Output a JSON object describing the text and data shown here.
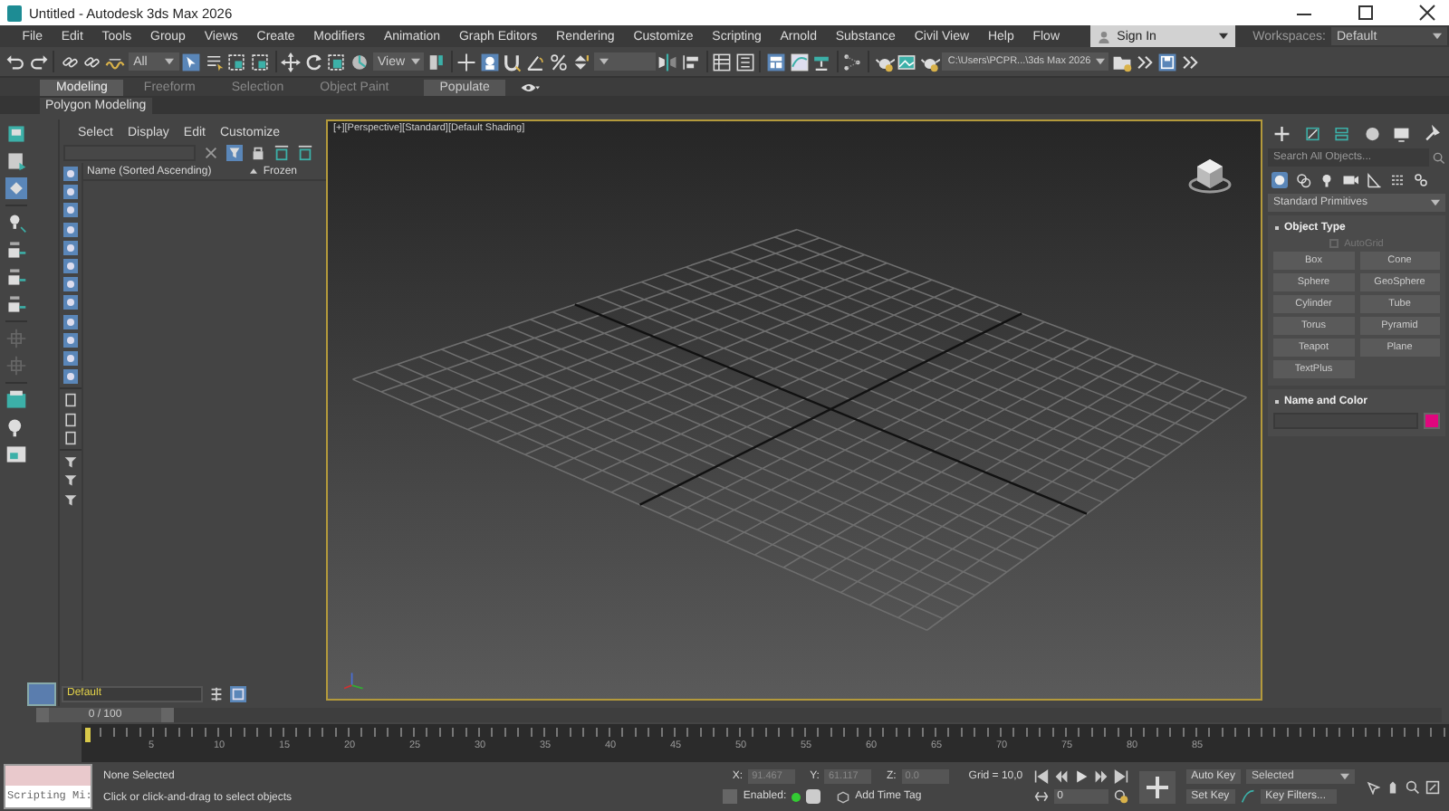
{
  "window": {
    "title": "Untitled - Autodesk 3ds Max 2026"
  },
  "menu": {
    "items": [
      "File",
      "Edit",
      "Tools",
      "Group",
      "Views",
      "Create",
      "Modifiers",
      "Animation",
      "Graph Editors",
      "Rendering",
      "Customize",
      "Scripting",
      "Arnold",
      "Substance",
      "Civil View",
      "Help",
      "Flow"
    ],
    "sign_in": "Sign In",
    "workspaces_label": "Workspaces:",
    "workspace": "Default"
  },
  "toolbar": {
    "selection_filter": "All",
    "reference_coordinate": "View",
    "project_path": "C:\\Users\\PCPR...\\3ds Max 2026"
  },
  "ribbon": {
    "tabs": [
      {
        "label": "Modeling",
        "selected": true
      },
      {
        "label": "Freeform",
        "selected": false
      },
      {
        "label": "Selection",
        "selected": false
      },
      {
        "label": "Object Paint",
        "selected": false
      }
    ],
    "populate": "Populate",
    "panel": "Polygon Modeling"
  },
  "scene_explorer": {
    "menu": [
      "Select",
      "Display",
      "Edit",
      "Customize"
    ],
    "columns": [
      "Name (Sorted Ascending)",
      "Frozen"
    ],
    "layer": "Default"
  },
  "viewport": {
    "label": "[+][Perspective][Standard][Default Shading]"
  },
  "command_panel": {
    "search_placeholder": "Search All Objects...",
    "category": "Standard Primitives",
    "object_type": {
      "title": "Object Type",
      "autogrid": {
        "label": "AutoGrid",
        "checked": false,
        "disabled": true
      },
      "buttons": [
        "Box",
        "Cone",
        "Sphere",
        "GeoSphere",
        "Cylinder",
        "Tube",
        "Torus",
        "Pyramid",
        "Teapot",
        "Plane",
        "TextPlus"
      ]
    },
    "name_and_color": {
      "title": "Name and Color",
      "color": "#e0067e"
    }
  },
  "timeline": {
    "frame_range": "0 / 100",
    "level": 0,
    "labels": [
      "5",
      "10",
      "15",
      "20",
      "25",
      "30",
      "35",
      "40",
      "45",
      "50",
      "55",
      "60",
      "65",
      "70",
      "75",
      "80",
      "85"
    ]
  },
  "status": {
    "listener": "Scripting Mi:",
    "selection": "None Selected",
    "prompt": "Click or click-and-drag to select objects",
    "coords": [
      {
        "label": "X:",
        "value": "91.467"
      },
      {
        "label": "Y:",
        "value": "61.117"
      },
      {
        "label": "Z:",
        "value": "0.0"
      }
    ],
    "grid": "Grid = 10,0",
    "enabled_label": "Enabled:",
    "add_time_tag": "Add Time Tag",
    "frame": "0",
    "auto_key": "Auto Key",
    "key_mode": "Selected",
    "set_key": "Set Key",
    "key_filters": "Key Filters..."
  }
}
